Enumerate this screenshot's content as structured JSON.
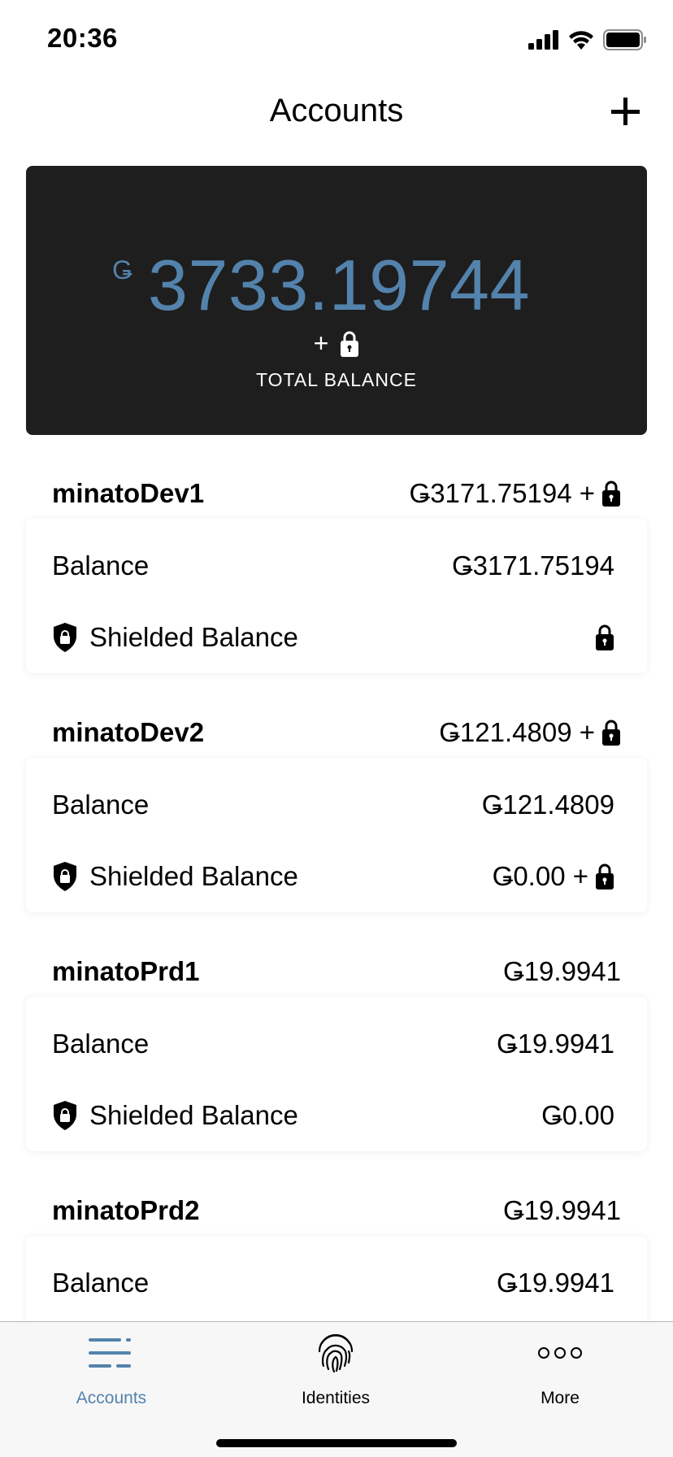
{
  "status_bar": {
    "time": "20:36"
  },
  "header": {
    "title": "Accounts"
  },
  "total": {
    "currency_symbol": "Ǥ",
    "amount": "3733.19744",
    "plus": "+",
    "label": "TOTAL BALANCE"
  },
  "accounts": [
    {
      "name": "minatoDev1",
      "total": "Ǥ3171.75194 +",
      "balance_label": "Balance",
      "balance": "Ǥ3171.75194",
      "shielded_label": "Shielded Balance",
      "shielded": ""
    },
    {
      "name": "minatoDev2",
      "total": "Ǥ121.4809 +",
      "balance_label": "Balance",
      "balance": "Ǥ121.4809",
      "shielded_label": "Shielded Balance",
      "shielded": "Ǥ0.00 +"
    },
    {
      "name": "minatoPrd1",
      "total": "Ǥ19.9941",
      "balance_label": "Balance",
      "balance": "Ǥ19.9941",
      "shielded_label": "Shielded Balance",
      "shielded": "Ǥ0.00"
    },
    {
      "name": "minatoPrd2",
      "total": "Ǥ19.9941",
      "balance_label": "Balance",
      "balance": "Ǥ19.9941"
    }
  ],
  "tabs": [
    {
      "label": "Accounts",
      "icon": "list-icon",
      "active": true
    },
    {
      "label": "Identities",
      "icon": "fingerprint-icon",
      "active": false
    },
    {
      "label": "More",
      "icon": "more-dots-icon",
      "active": false
    }
  ],
  "colors": {
    "accent": "#5383ac",
    "card": "#1e1e1e"
  }
}
